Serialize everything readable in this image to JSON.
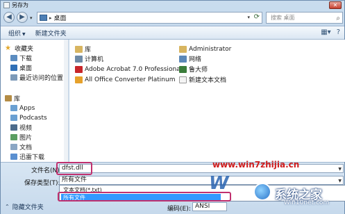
{
  "window": {
    "title": "另存为"
  },
  "address": {
    "path": "桌面",
    "search_placeholder": "搜索 桌面"
  },
  "toolbar": {
    "organize": "组织",
    "new_folder": "新建文件夹"
  },
  "sidebar": {
    "items": [
      {
        "label": "收藏夹"
      },
      {
        "label": "下载"
      },
      {
        "label": "桌面"
      },
      {
        "label": "最近访问的位置"
      },
      {
        "label": "库"
      },
      {
        "label": "Apps"
      },
      {
        "label": "Podcasts"
      },
      {
        "label": "视频"
      },
      {
        "label": "图片"
      },
      {
        "label": "文档"
      },
      {
        "label": "迅雷下载"
      }
    ]
  },
  "files": {
    "left": [
      {
        "label": "库"
      },
      {
        "label": "计算机"
      },
      {
        "label": "Adobe Acrobat 7.0 Professional"
      },
      {
        "label": "All Office Converter Platinum"
      }
    ],
    "right": [
      {
        "label": "Administrator"
      },
      {
        "label": "网络"
      },
      {
        "label": "鲁大师"
      },
      {
        "label": "新建文本文档"
      }
    ]
  },
  "form": {
    "filename_label": "文件名(N):",
    "filename_value": "dfst.dll",
    "type_label": "保存类型(T):",
    "type_value": "所有文件",
    "type_options": [
      "文本文档(*.txt)",
      "所有文件"
    ],
    "encoding_label": "编码(E):",
    "encoding_value": "ANSI",
    "hide_folders": "隐藏文件夹"
  },
  "watermark": {
    "url": "www.win7zhijia.cn",
    "brand": "系统之家",
    "site": "Win10net.com"
  }
}
